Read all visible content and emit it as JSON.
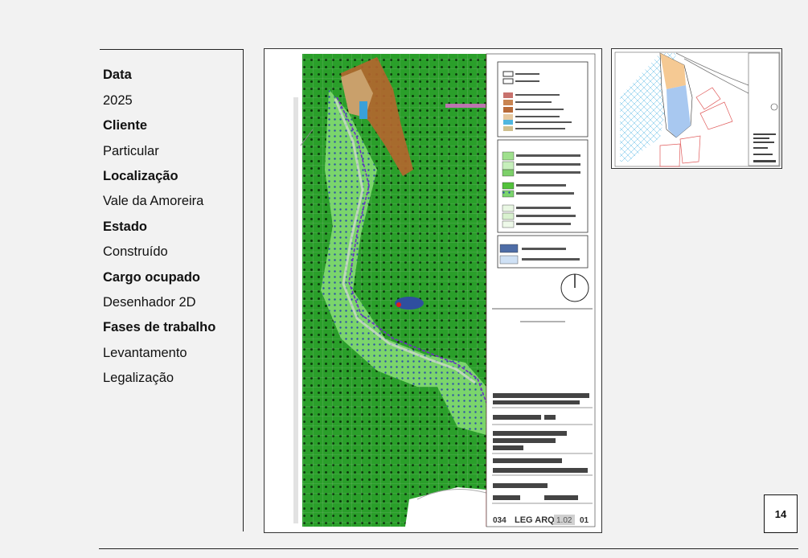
{
  "project": {
    "fields": [
      {
        "label": "Data",
        "value": "2025"
      },
      {
        "label": "Cliente",
        "value": "Particular"
      },
      {
        "label": "Localização",
        "value": "Vale da Amoreira"
      },
      {
        "label": "Estado",
        "value": "Construído"
      },
      {
        "label": "Cargo ocupado",
        "value": "Desenhador 2D"
      },
      {
        "label": "Fases de trabalho",
        "values": [
          "Levantamento",
          "Legalização"
        ]
      }
    ]
  },
  "drawing": {
    "title_block": {
      "company": "LEG ARQ",
      "scale": "1.02",
      "sheet": "01",
      "code": "034"
    }
  },
  "colors": {
    "map_green": "#1f9a1f",
    "map_light_green": "#7ad36a",
    "water_blue": "#2f4f9f",
    "urban_brown": "#b5652e",
    "background": "#f2f2f2"
  },
  "page": {
    "number": "14"
  }
}
